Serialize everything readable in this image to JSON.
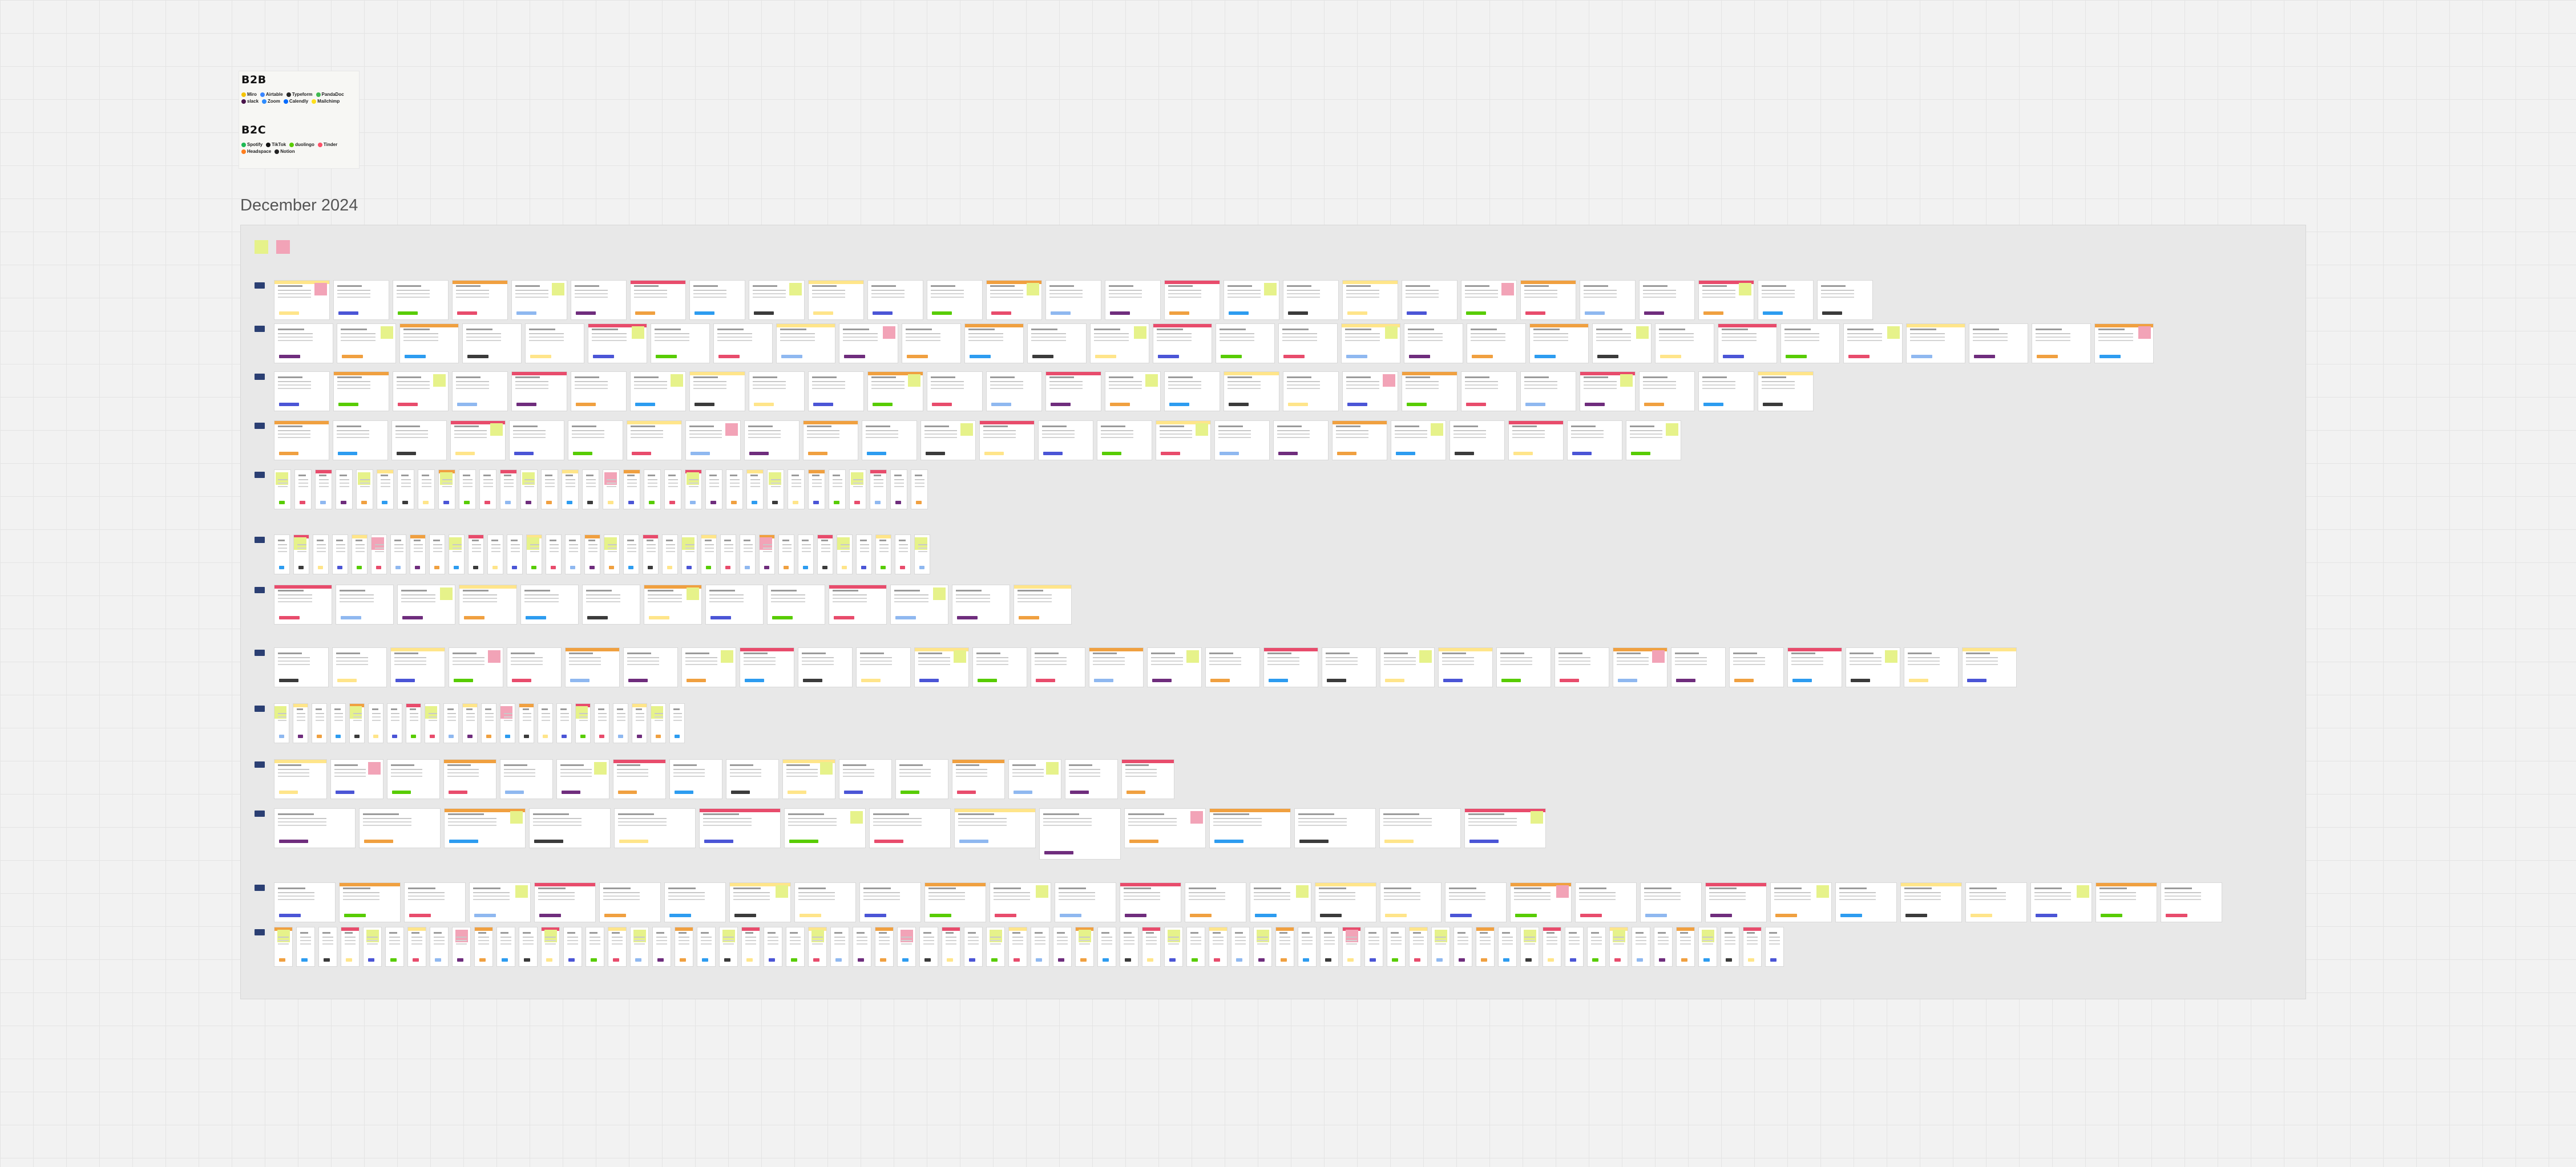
{
  "board_label": "December 2024",
  "colors": {
    "note_yellow": "#e6f28a",
    "note_pink": "#f2a3b7",
    "row_tag": "#2b3f73"
  },
  "logo_card": {
    "b2b_heading": "B2B",
    "b2b_logos": [
      {
        "name": "Miro",
        "icon_color": "#f5c400"
      },
      {
        "name": "Airtable",
        "icon_color": "#3a86ff"
      },
      {
        "name": "Typeform",
        "icon_color": "#262626"
      },
      {
        "name": "PandaDoc",
        "icon_color": "#3fb950"
      },
      {
        "name": "slack",
        "icon_color": "#4a154b"
      },
      {
        "name": "Zoom",
        "icon_color": "#2d8cff"
      },
      {
        "name": "Calendly",
        "icon_color": "#006bff"
      },
      {
        "name": "Mailchimp",
        "icon_color": "#ffe01b"
      }
    ],
    "b2c_heading": "B2C",
    "b2c_logos": [
      {
        "name": "Spotify",
        "icon_color": "#1db954"
      },
      {
        "name": "TikTok",
        "icon_color": "#111111"
      },
      {
        "name": "duolingo",
        "icon_color": "#58cc02"
      },
      {
        "name": "Tinder",
        "icon_color": "#fd5068"
      },
      {
        "name": "Headspace",
        "icon_color": "#ff7e1d"
      },
      {
        "name": "Notion",
        "icon_color": "#222222"
      }
    ]
  }
}
